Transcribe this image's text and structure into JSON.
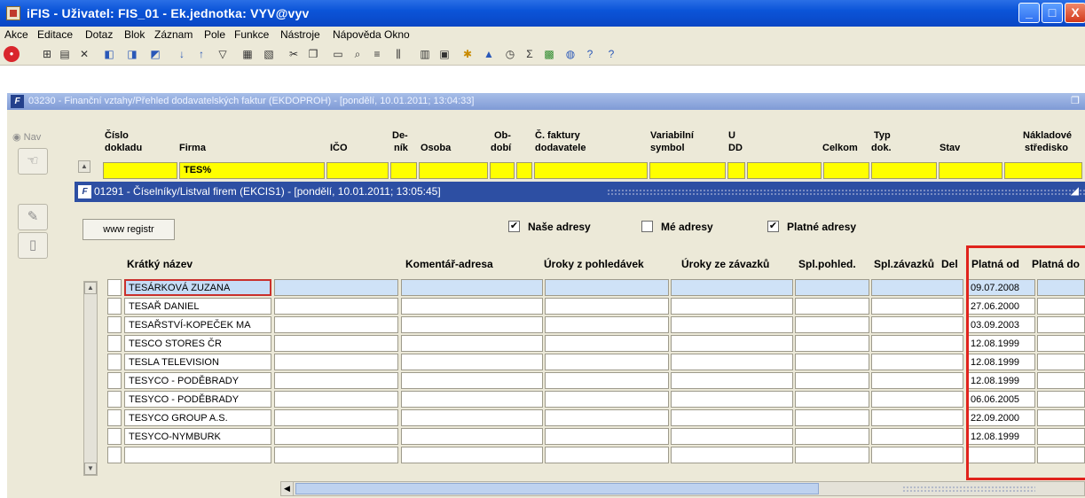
{
  "window": {
    "title": "iFIS - Uživatel: FIS_01 - Ek.jednotka: VYV@vyv",
    "minimize": "_",
    "maximize": "□",
    "close": "X"
  },
  "menu": [
    "Akce",
    "Editace",
    "Dotaz",
    "Blok",
    "Záznam",
    "Pole",
    "Funkce",
    "Nástroje",
    "Nápověda",
    "Okno"
  ],
  "toolbar_icons": [
    "stop-icon",
    "insert-record-icon",
    "save-icon",
    "clear-icon",
    "query-icon",
    "execute-query-icon",
    "cancel-query-icon",
    "sort-asc-icon",
    "sort-desc-icon",
    "filter-icon",
    "print-icon",
    "print-preview-icon",
    "cut-icon",
    "copy-icon",
    "paste-icon",
    "find-icon",
    "list-icon",
    "columns-icon",
    "export-icon",
    "calc-icon",
    "star-icon",
    "chart-icon",
    "clock-icon",
    "sum-icon",
    "grid-icon",
    "globe-icon",
    "help-user-icon",
    "help-icon"
  ],
  "outer_window": {
    "title": "03230 - Finanční vztahy/Přehled dodavatelských faktur (EKDOPROH) - [pondělí, 10.01.2011; 13:04:33]",
    "nav": "Nav",
    "headers": {
      "cislo": "Číslo",
      "dokladu": "dokladu",
      "firma": "Firma",
      "ico": "IČO",
      "de": "De-",
      "nik": "ník",
      "osoba": "Osoba",
      "ob": "Ob-",
      "dobi": "dobí",
      "c_faktury": "Č. faktury",
      "dodavatele": "dodavatele",
      "variabilni": "Variabilní",
      "symbol": "symbol",
      "u": "U",
      "dd": "DD",
      "typ": "Typ",
      "celkom": "Celkom",
      "dok": "dok.",
      "stav": "Stav",
      "nakladove": "Nákladové",
      "stredisko": "středisko"
    },
    "firma_query": "TES%"
  },
  "inner_window": {
    "title": "01291 - Číselníky/Listval firem (EKCIS1) - [pondělí, 10.01.2011; 13:05:45]",
    "www_button": "www registr",
    "checkboxes": [
      {
        "label": "Naše adresy",
        "checked": true,
        "mark": "✔"
      },
      {
        "label": "Mé adresy",
        "checked": false,
        "mark": ""
      },
      {
        "label": "Platné adresy",
        "checked": true,
        "mark": "✔"
      }
    ],
    "columns": [
      "Krátký název",
      "Komentář-adresa",
      "Úroky z pohledávek",
      "Úroky ze závazků",
      "Spl.pohled.",
      "Spl.závazků",
      "Del",
      "Platná od",
      "Platná do"
    ],
    "rows": [
      {
        "name": "TESÁRKOVÁ ZUZANA",
        "platna_od": "09.07.2008"
      },
      {
        "name": "TESAŘ DANIEL",
        "platna_od": "27.06.2000"
      },
      {
        "name": "TESAŘSTVÍ-KOPEČEK MA",
        "platna_od": "03.09.2003"
      },
      {
        "name": "TESCO STORES ČR",
        "platna_od": "12.08.1999"
      },
      {
        "name": "TESLA TELEVISION",
        "platna_od": "12.08.1999"
      },
      {
        "name": "TESYCO - PODĚBRADY",
        "platna_od": "12.08.1999"
      },
      {
        "name": "TESYCO - PODĚBRADY",
        "platna_od": "06.06.2005"
      },
      {
        "name": "TESYCO GROUP A.S.",
        "platna_od": "22.09.2000"
      },
      {
        "name": "TESYCO-NYMBURK",
        "platna_od": "12.08.1999"
      },
      {
        "name": "",
        "platna_od": ""
      }
    ]
  }
}
